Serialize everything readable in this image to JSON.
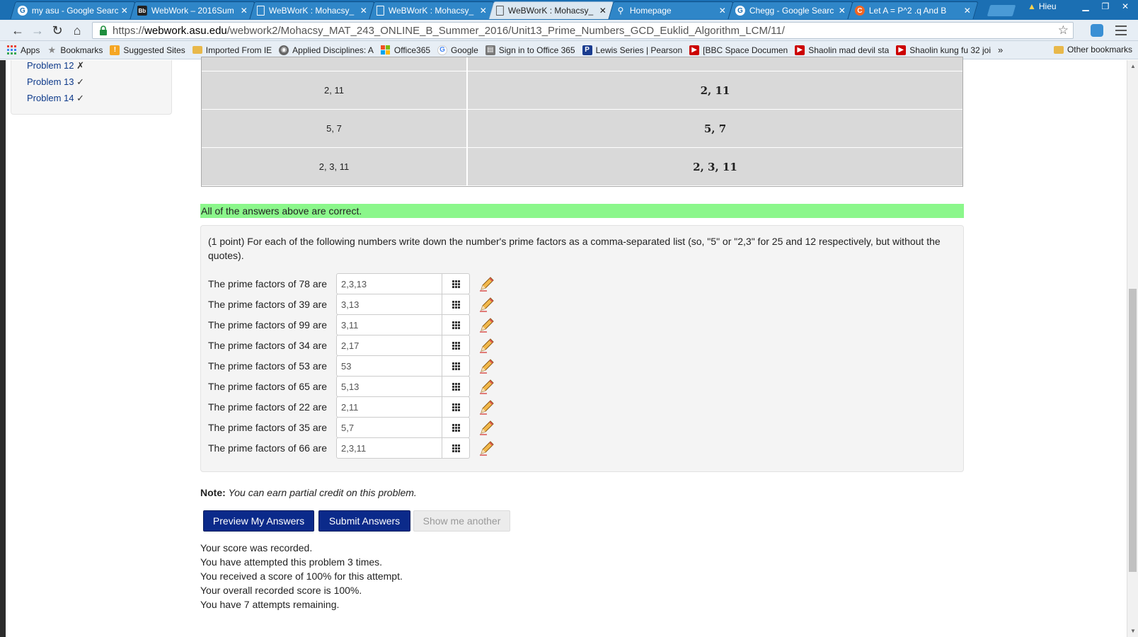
{
  "browser": {
    "tabs": [
      {
        "title": "my asu - Google Searc",
        "favicon": "G",
        "active": false
      },
      {
        "title": "WebWork – 2016Sum",
        "favicon": "Bb",
        "active": false
      },
      {
        "title": "WeBWorK : Mohacsy_",
        "favicon": "doc",
        "active": false
      },
      {
        "title": "WeBWorK : Mohacsy_",
        "favicon": "doc",
        "active": false
      },
      {
        "title": "WeBWorK : Mohacsy_",
        "favicon": "doc",
        "active": true
      },
      {
        "title": "Homepage",
        "favicon": "search",
        "active": false
      },
      {
        "title": "Chegg - Google Searc",
        "favicon": "G",
        "active": false
      },
      {
        "title": "Let A = P^2 .q And B",
        "favicon": "C",
        "active": false
      }
    ],
    "profile_name": "Hieu",
    "url_scheme": "https://",
    "url_host": "webwork.asu.edu",
    "url_path": "/webwork2/Mohacsy_MAT_243_ONLINE_B_Summer_2016/Unit13_Prime_Numbers_GCD_Euklid_Algorithm_LCM/11/",
    "bookmarks": [
      {
        "label": "Apps",
        "icon": "apps-grid-icon",
        "color": "#e94235"
      },
      {
        "label": "Bookmarks",
        "icon": "star-icon",
        "color": "#888888"
      },
      {
        "label": "Suggested Sites",
        "icon": "suggested-icon",
        "color": "#f5a623"
      },
      {
        "label": "Imported From IE",
        "icon": "folder-icon",
        "color": "#e8b84a"
      },
      {
        "label": "Applied Disciplines: A",
        "icon": "site-icon",
        "color": "#666666"
      },
      {
        "label": "Office365",
        "icon": "office-icon",
        "color": "#e94235"
      },
      {
        "label": "Google",
        "icon": "google-icon",
        "color": "#4285f4"
      },
      {
        "label": "Sign in to Office 365",
        "icon": "office-icon",
        "color": "#777777"
      },
      {
        "label": "Lewis Series | Pearson",
        "icon": "pearson-icon",
        "color": "#1a3c8f"
      },
      {
        "label": "[BBC Space Documen",
        "icon": "youtube-icon",
        "color": "#cc0000"
      },
      {
        "label": "Shaolin mad devil sta",
        "icon": "youtube-icon",
        "color": "#cc0000"
      },
      {
        "label": "Shaolin kung fu 32 joi",
        "icon": "youtube-icon",
        "color": "#cc0000"
      }
    ],
    "overflow_label": "»",
    "other_bookmarks": "Other bookmarks"
  },
  "sidebar": {
    "problems": [
      {
        "label": "Problem 12",
        "mark": "✗"
      },
      {
        "label": "Problem 13",
        "mark": "✓"
      },
      {
        "label": "Problem 14",
        "mark": "✓"
      }
    ]
  },
  "answer_table": {
    "rows": [
      {
        "entered": "2, 11",
        "preview": "2, 11"
      },
      {
        "entered": "5, 7",
        "preview": "5, 7"
      },
      {
        "entered": "2, 3, 11",
        "preview": "2, 3, 11"
      }
    ]
  },
  "banner": "All of the answers above are correct.",
  "problem": {
    "text": "(1 point) For each of the following numbers write down the number's prime factors as a comma-separated list (so, \"5\" or \"2,3\" for 25 and 12 respectively, but without the quotes).",
    "questions": [
      {
        "label": "The prime factors of 78 are",
        "value": "2,3,13"
      },
      {
        "label": "The prime factors of 39 are",
        "value": "3,13"
      },
      {
        "label": "The prime factors of 99 are",
        "value": "3,11"
      },
      {
        "label": "The prime factors of 34 are",
        "value": "2,17"
      },
      {
        "label": "The prime factors of 53 are",
        "value": "53"
      },
      {
        "label": "The prime factors of 65 are",
        "value": "5,13"
      },
      {
        "label": "The prime factors of 22 are",
        "value": "2,11"
      },
      {
        "label": "The prime factors of 35 are",
        "value": "5,7"
      },
      {
        "label": "The prime factors of 66 are",
        "value": "2,3,11"
      }
    ]
  },
  "note": {
    "label": "Note:",
    "text": "You can earn partial credit on this problem."
  },
  "buttons": {
    "preview": "Preview My Answers",
    "submit": "Submit Answers",
    "another": "Show me another"
  },
  "score_messages": [
    "Your score was recorded.",
    "You have attempted this problem 3 times.",
    "You received a score of 100% for this attempt.",
    "Your overall recorded score is 100%.",
    "You have 7 attempts remaining."
  ],
  "colors": {
    "tabstrip": "#1b6fb3",
    "primary_button": "#0b2a8a",
    "correct_banner": "#8bf78b"
  }
}
